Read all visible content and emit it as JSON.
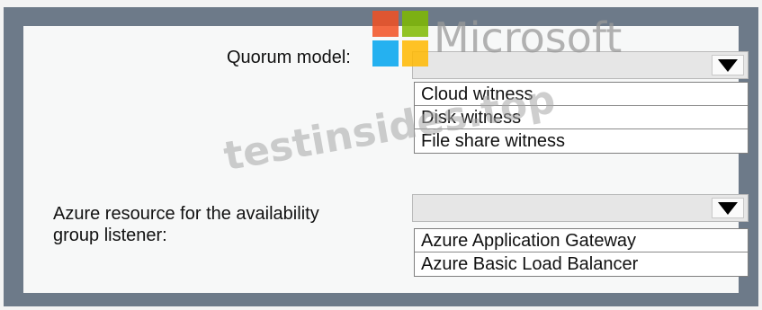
{
  "quorum": {
    "label": "Quorum model:",
    "selected": "",
    "options": [
      "Cloud witness",
      "Disk witness",
      "File share witness"
    ]
  },
  "listener": {
    "label_line1": "Azure resource for the availability",
    "label_line2": "group listener:",
    "selected": "",
    "options": [
      "Azure Application Gateway",
      "Azure Basic Load Balancer"
    ]
  },
  "overlay": {
    "logo_text": "Microsoft",
    "watermark_text": "testinsides.top"
  },
  "colors": {
    "frame": "#6d7a89",
    "panel": "#f7f8f8",
    "dropdown_bg": "#e6e6e6",
    "logo_red": "#f25022",
    "logo_green": "#7fba00",
    "logo_blue": "#00a4ef",
    "logo_yellow": "#ffb900"
  },
  "icons": {
    "dropdown_arrow": "triangle-down-icon"
  }
}
